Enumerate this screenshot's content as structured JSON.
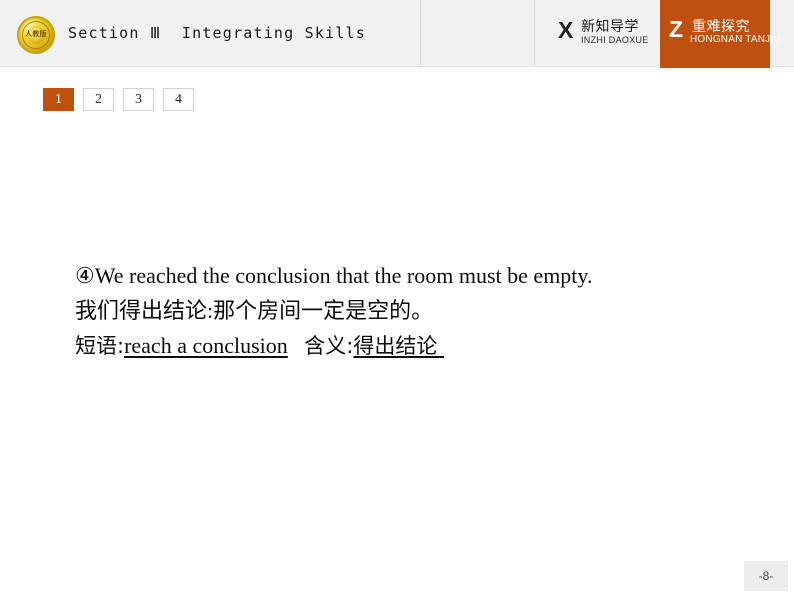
{
  "header": {
    "logo_icon": "gold-seal-logo",
    "logo_text": "人教版",
    "title": "Section Ⅲ  Integrating Skills",
    "badges": [
      {
        "letter": "X",
        "chinese": "新知导学",
        "pinyin": "INZHI DAOXUE",
        "active": false,
        "name": "badge-xinzhi-daoxue"
      },
      {
        "letter": "Z",
        "chinese": "重难探究",
        "pinyin": "HONGNAN TANJIU",
        "active": true,
        "name": "badge-zhongnan-tanjiu"
      }
    ]
  },
  "tabs": [
    {
      "label": "1",
      "active": true
    },
    {
      "label": "2",
      "active": false
    },
    {
      "label": "3",
      "active": false
    },
    {
      "label": "4",
      "active": false
    }
  ],
  "content": {
    "line1": "④We reached the conclusion that the room must be empty.",
    "line2": "我们得出结论:那个房间一定是空的。",
    "line3_label_phrase": "短语:",
    "line3_phrase": "reach a conclusion",
    "line3_gap": "   ",
    "line3_label_meaning": "含义:",
    "line3_meaning": "得出结论 "
  },
  "footer": {
    "page_number": "-8-"
  },
  "colors": {
    "accent_orange": "#c0500f",
    "header_gray": "#f1f1f1",
    "page_badge_gray": "#ededed",
    "text_black": "#0d0d0d"
  }
}
